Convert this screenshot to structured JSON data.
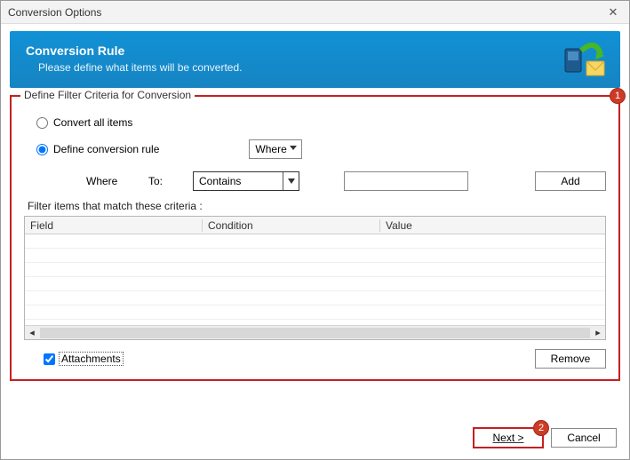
{
  "window": {
    "title": "Conversion Options"
  },
  "banner": {
    "title": "Conversion Rule",
    "subtitle": "Please define what items will be converted."
  },
  "fieldset": {
    "legend": "Define Filter Criteria for Conversion"
  },
  "radio": {
    "convert_all": "Convert all items",
    "define_rule": "Define conversion rule"
  },
  "where_select": {
    "label": "Where"
  },
  "filter_bar": {
    "where": "Where",
    "to": "To:",
    "condition": "Contains",
    "value": "",
    "add": "Add"
  },
  "criteria_label": "Filter items that match these criteria :",
  "table": {
    "headers": {
      "field": "Field",
      "condition": "Condition",
      "value": "Value"
    }
  },
  "attachments": {
    "label": "Attachments"
  },
  "remove": "Remove",
  "footer": {
    "next": "Next >",
    "cancel": "Cancel"
  },
  "badges": {
    "one": "1",
    "two": "2"
  }
}
